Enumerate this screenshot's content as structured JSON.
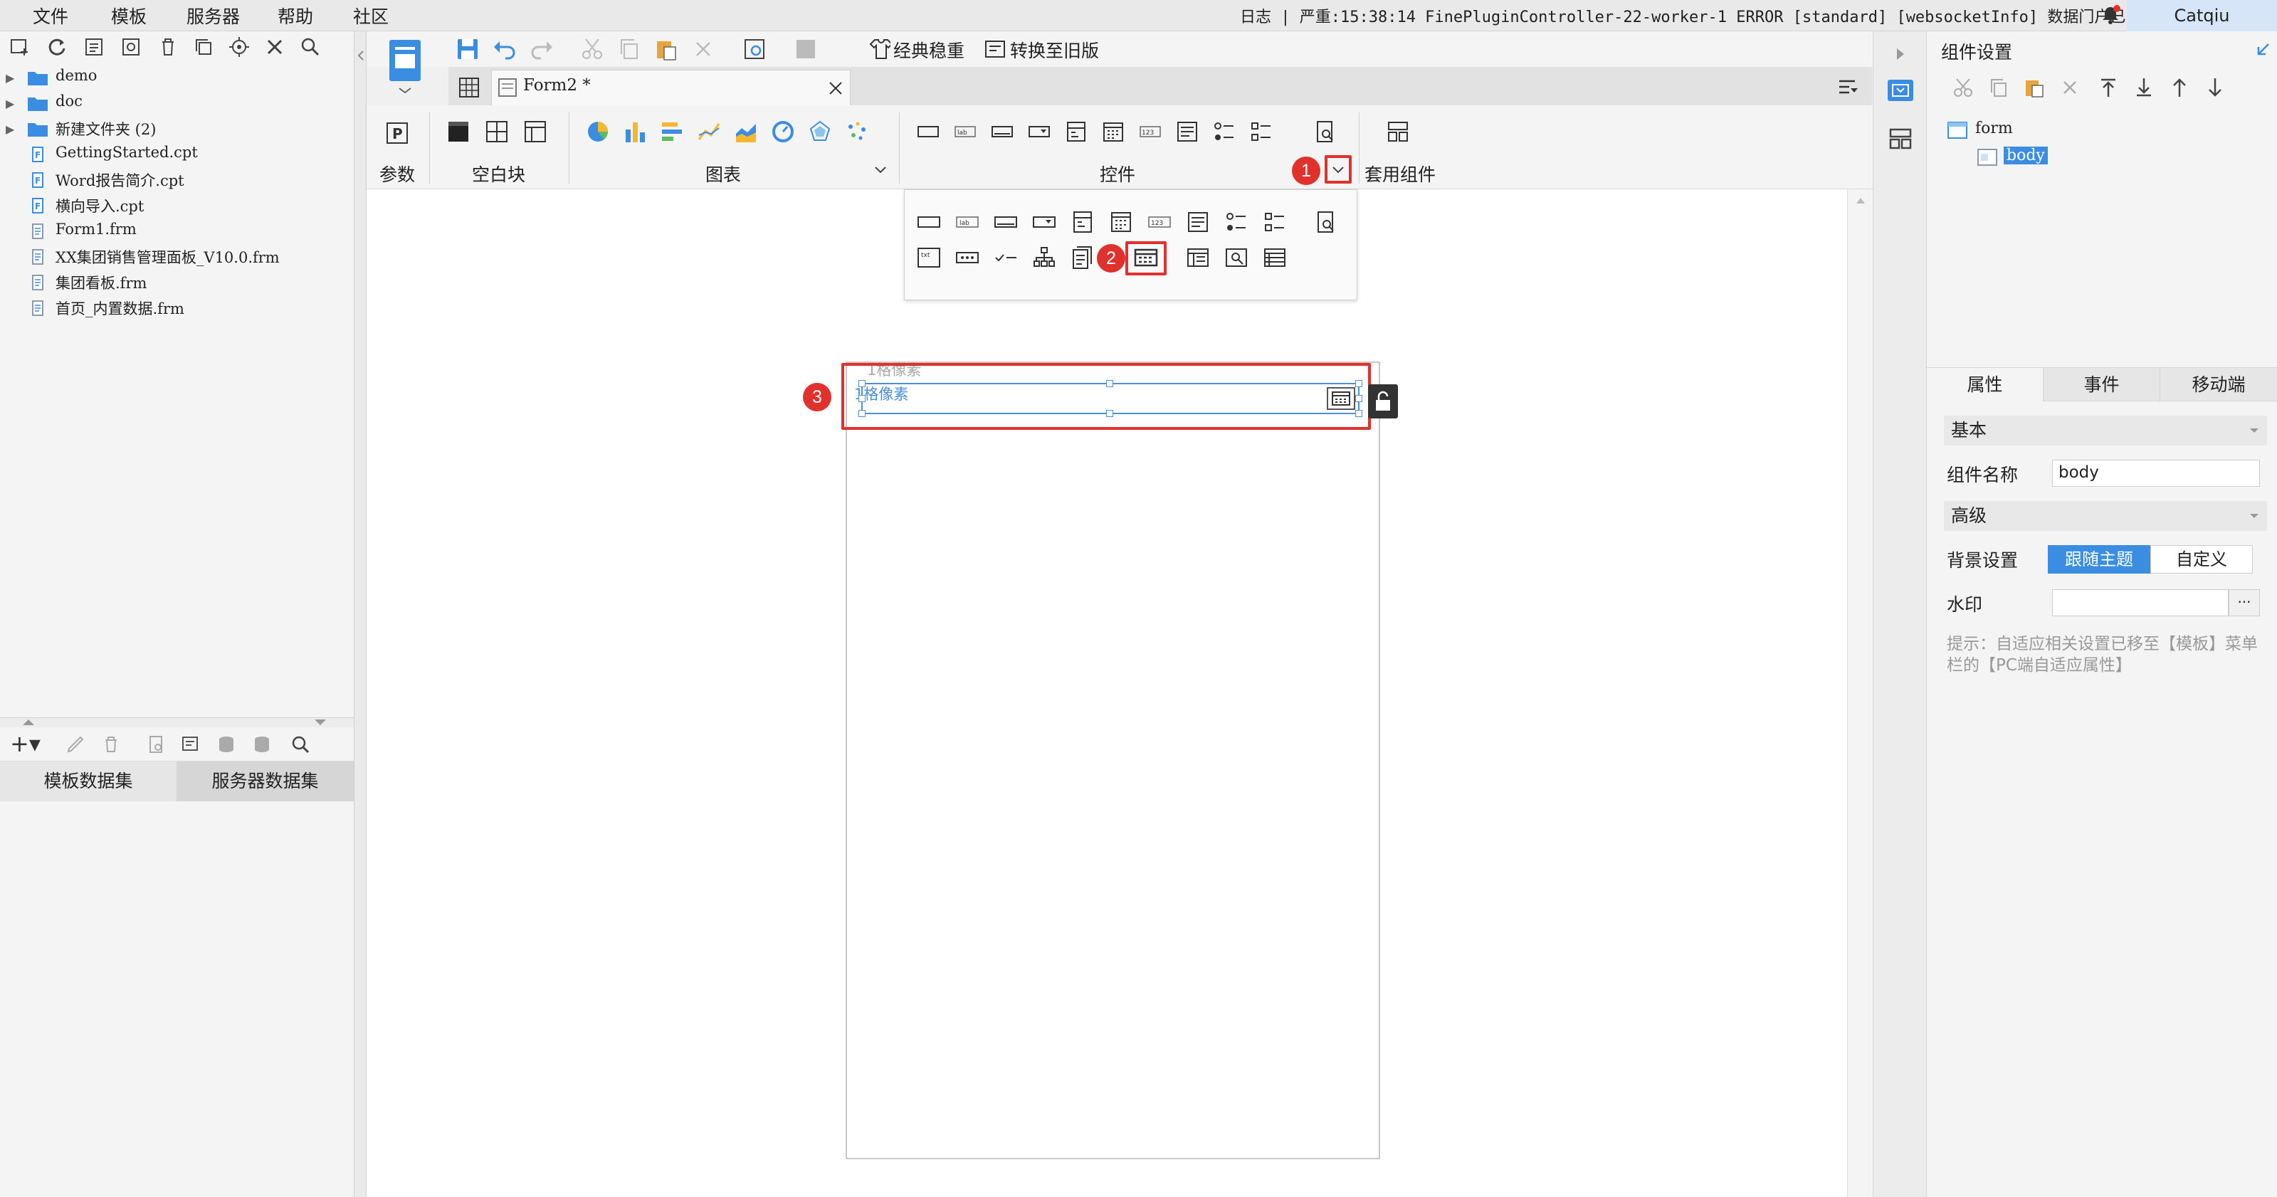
{
  "menubar": {
    "items": [
      "文件",
      "模板",
      "服务器",
      "帮助",
      "社区"
    ],
    "log_text": "日志 | 严重:15:38:14 FinePluginController-22-worker-1 ERROR [standard] [websocketInfo] 数据门户已...",
    "user": "Catqiu"
  },
  "file_tree": {
    "items": [
      {
        "label": "demo",
        "type": "folder",
        "expandable": true
      },
      {
        "label": "doc",
        "type": "folder",
        "expandable": true
      },
      {
        "label": "新建文件夹 (2)",
        "type": "folder",
        "expandable": true
      },
      {
        "label": "GettingStarted.cpt",
        "type": "cpt"
      },
      {
        "label": "Word报告简介.cpt",
        "type": "cpt"
      },
      {
        "label": "横向导入.cpt",
        "type": "cpt"
      },
      {
        "label": "Form1.frm",
        "type": "frm"
      },
      {
        "label": "XX集团销售管理面板_V10.0.frm",
        "type": "frm"
      },
      {
        "label": "集团看板.frm",
        "type": "frm"
      },
      {
        "label": "首页_内置数据.frm",
        "type": "frm"
      }
    ]
  },
  "dataset_tabs": [
    "模板数据集",
    "服务器数据集"
  ],
  "toolbar": {
    "classic_label": "经典稳重",
    "switch_label": "转换至旧版"
  },
  "doc_tab": {
    "title": "Form2 *"
  },
  "ribbon": {
    "groups": [
      "参数",
      "空白块",
      "图表",
      "控件",
      "套用组件"
    ],
    "collapse_arrow": "chevron-down"
  },
  "canvas": {
    "ghost_label": "1格像素",
    "widget_label": "1格像素"
  },
  "annotations": [
    "1",
    "2",
    "3"
  ],
  "right_panel": {
    "title": "组件设置",
    "tree": [
      {
        "label": "form"
      },
      {
        "label": "body"
      }
    ],
    "tabs": [
      "属性",
      "事件",
      "移动端"
    ],
    "sections": {
      "basic": "基本",
      "advanced": "高级"
    },
    "props": {
      "name_label": "组件名称",
      "name_value": "body",
      "bg_label": "背景设置",
      "bg_options": [
        "跟随主题",
        "自定义"
      ],
      "watermark_label": "水印",
      "watermark_btn": "···"
    },
    "hint": "提示：自适应相关设置已移至【模板】菜单栏的【PC端自适应属性】"
  },
  "colors": {
    "accent": "#4a90e2",
    "annotation_red": "#e0312c"
  }
}
